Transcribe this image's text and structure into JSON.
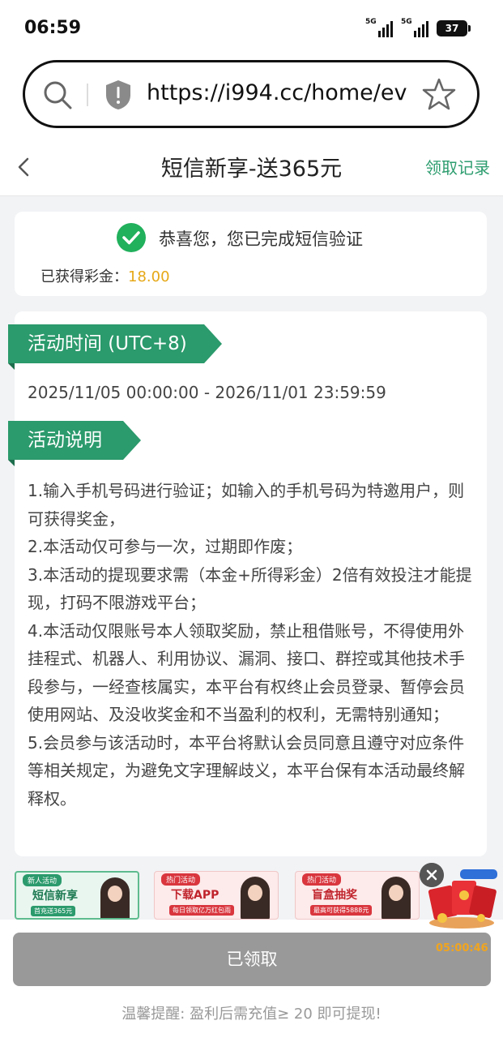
{
  "status_bar": {
    "time": "06:59",
    "signal_1_label": "5G",
    "signal_2_label": "5G",
    "battery": "37"
  },
  "browser": {
    "url": "https://i994.cc/home/ev..."
  },
  "header": {
    "title": "短信新享-送365元",
    "records_link": "领取记录"
  },
  "verify_card": {
    "message": "恭喜您，您已完成短信验证",
    "bonus_label": "已获得彩金：",
    "bonus_value": "18.00"
  },
  "activity": {
    "time_heading": "活动时间 (UTC+8)",
    "time_range": "2025/11/05 00:00:00 - 2026/11/01 23:59:59",
    "desc_heading": "活动说明",
    "rules": [
      "1.输入手机号码进行验证；如输入的手机号码为特邀用户，则可获得奖金，",
      "2.本活动仅可参与一次，过期即作废；",
      "3.本活动的提现要求需（本金+所得彩金）2倍有效投注才能提现，打码不限游戏平台；",
      "4.本活动仅限账号本人领取奖励，禁止租借账号，不得使用外挂程式、机器人、利用协议、漏洞、接口、群控或其他技术手段参与，一经查核属实，本平台有权终止会员登录、暂停会员使用网站、及没收奖金和不当盈利的权利，无需特别通知；",
      "5.会员参与该活动时，本平台将默认会员同意且遵守对应条件等相关规定，为避免文字理解歧义，本平台保有本活动最终解释权。"
    ]
  },
  "banners": [
    {
      "tag": "新人活动",
      "title": "短信新享",
      "sub": "首充送365元"
    },
    {
      "tag": "热门活动",
      "title": "下载APP",
      "sub": "每日领取亿万红包雨"
    },
    {
      "tag": "热门活动",
      "title": "盲盒抽奖",
      "sub": "最高可获得5888元"
    }
  ],
  "floating": {
    "countdown": "05:00:46"
  },
  "bottom": {
    "claim_button": "已领取",
    "tip": "温馨提醒: 盈利后需充值≥ 20 即可提现!"
  },
  "colors": {
    "accent_green": "#2b9a6c",
    "bonus_gold": "#e6a817",
    "disabled_button": "#999999"
  }
}
